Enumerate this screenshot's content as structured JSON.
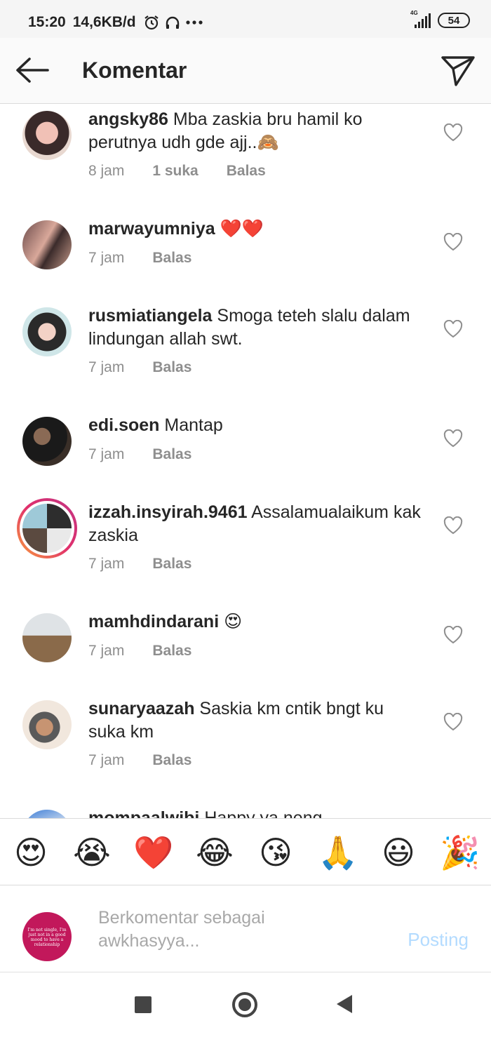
{
  "status_bar": {
    "time": "15:20",
    "speed": "14,6KB/d",
    "network": "4G",
    "battery": "54"
  },
  "header": {
    "title": "Komentar"
  },
  "comments": [
    {
      "username": "angsky86",
      "text": "Mba zaskia bru hamil ko perutnya udh gde ajj..🙈",
      "time": "8 jam",
      "likes": "1 suka",
      "reply": "Balas"
    },
    {
      "username": "marwayumniya",
      "text": "❤️❤️",
      "time": "7 jam",
      "reply": "Balas"
    },
    {
      "username": "rusmiatiangela",
      "text": "Smoga teteh slalu dalam lindungan allah swt.",
      "time": "7 jam",
      "reply": "Balas"
    },
    {
      "username": "edi.soen",
      "text": "Mantap",
      "time": "7 jam",
      "reply": "Balas"
    },
    {
      "username": "izzah.insyirah.9461",
      "text": "Assalamualaikum kak zaskia",
      "time": "7 jam",
      "reply": "Balas"
    },
    {
      "username": "mamhdindarani",
      "text": "😍",
      "time": "7 jam",
      "reply": "Balas"
    },
    {
      "username": "sunaryaazah",
      "text": "Saskia km cntik bngt ku suka km",
      "time": "7 jam",
      "reply": "Balas"
    },
    {
      "username": "mompaalwibi",
      "text": "Happy ya neng"
    }
  ],
  "emoji_bar": [
    "😍",
    "😭",
    "❤️",
    "😂",
    "😘",
    "🙏",
    "😃",
    "🎉"
  ],
  "composer": {
    "placeholder": "Berkomentar sebagai awkhasyya...",
    "post_label": "Posting",
    "avatar_text": "I'm not single, I'm just not in a good mood to have a relationship"
  },
  "colors": {
    "text": "#262626",
    "muted": "#8e8e8e",
    "post_disabled": "#b3dbff"
  }
}
